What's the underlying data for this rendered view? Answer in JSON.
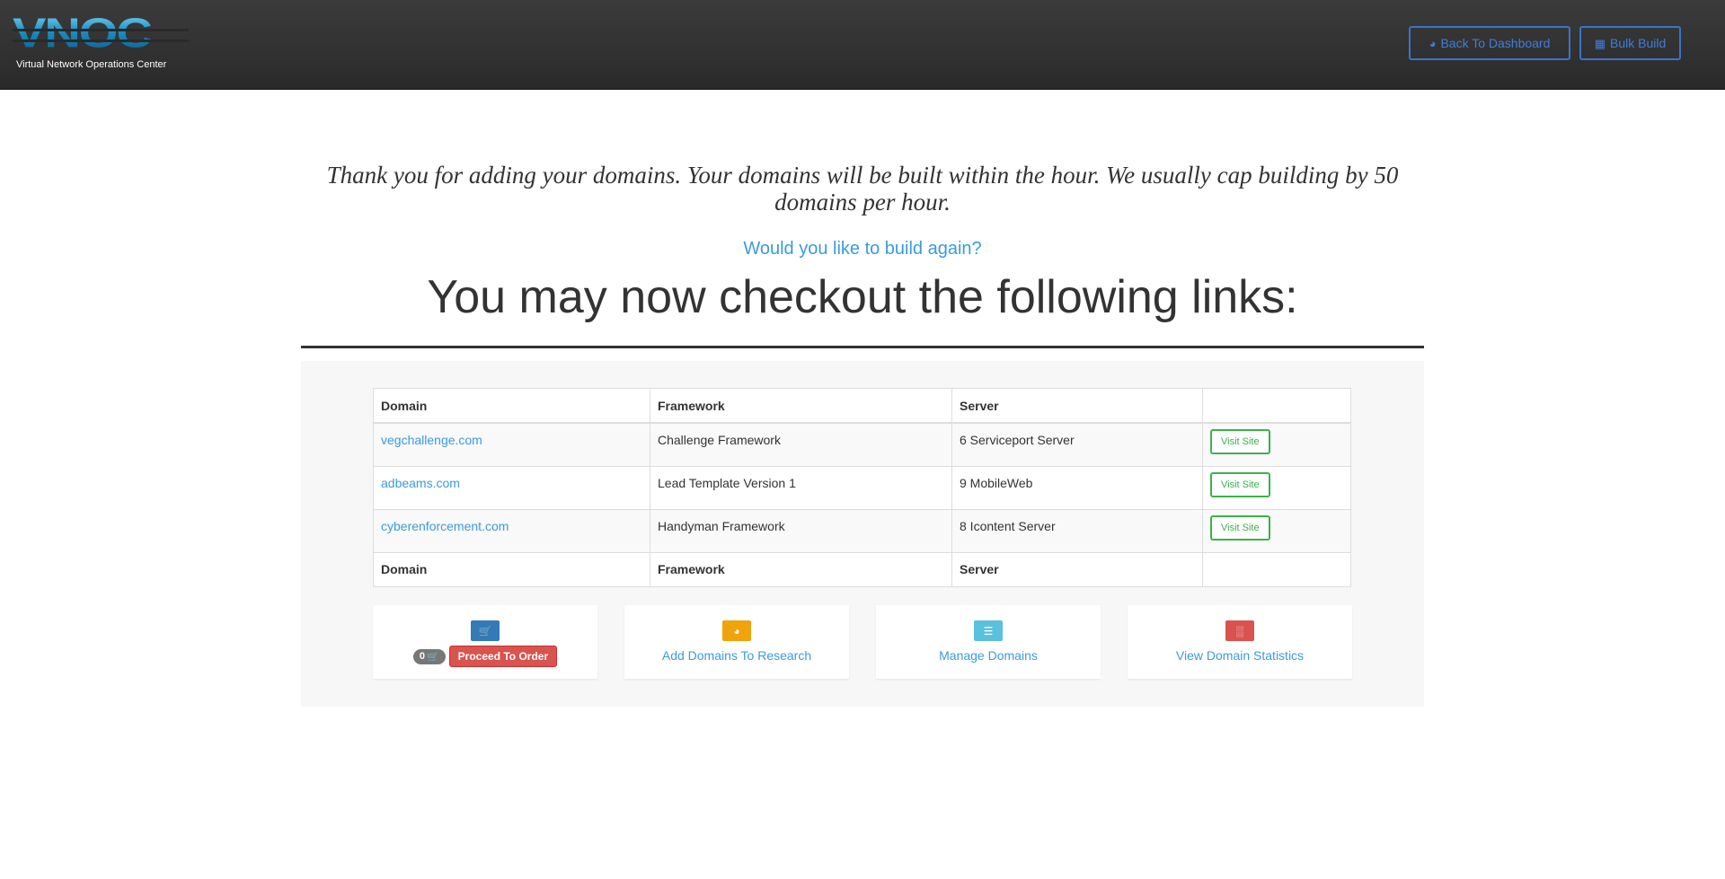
{
  "brand": {
    "logo_text": "VNOC",
    "subtitle": "Virtual Network Operations Center"
  },
  "header": {
    "dashboard_label": "Back To Dashboard",
    "bulk_label": "Bulk Build",
    "button_color": "#3a73c9"
  },
  "main": {
    "thanks_text": "Thank you for adding your domains. Your domains will be built within the hour. We usually cap building by 50 domains per hour.",
    "again_link": "Would you like to build again?",
    "headline": "You may now checkout the following links:"
  },
  "table": {
    "headers": [
      "Domain",
      "Framework",
      "Server",
      ""
    ],
    "rows": [
      {
        "domain": "vegchallenge.com",
        "framework": "Challenge Framework",
        "server": "6 Serviceport Server",
        "action": "Visit Site"
      },
      {
        "domain": "adbeams.com",
        "framework": "Lead Template Version 1",
        "server": "9 MobileWeb",
        "action": "Visit Site"
      },
      {
        "domain": "cyberenforcement.com",
        "framework": "Handyman Framework",
        "server": "8 Icontent Server",
        "action": "Visit Site"
      }
    ],
    "footer": [
      "Domain",
      "Framework",
      "Server",
      ""
    ]
  },
  "cards": {
    "cart_count": "0",
    "order_label": "Proceed To Order",
    "research_label": "Add Domains To Research",
    "manage_label": "Manage Domains",
    "stats_label": "View Domain Statistics",
    "colors": {
      "cart": "#337ab7",
      "research": "#f0a30a",
      "manage": "#5bc0de",
      "stats": "#d9534f"
    }
  }
}
